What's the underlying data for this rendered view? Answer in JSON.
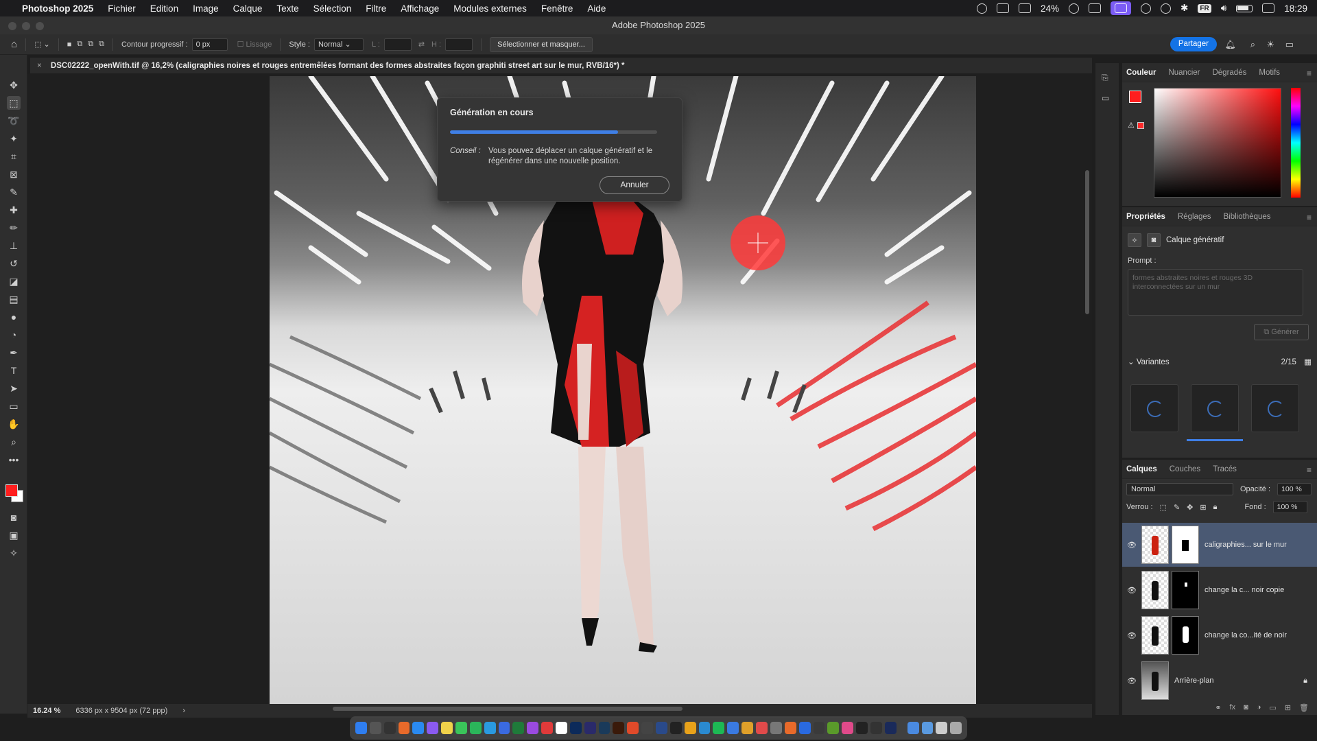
{
  "menubar": {
    "app_name": "Photoshop 2025",
    "items": [
      "Fichier",
      "Edition",
      "Image",
      "Calque",
      "Texte",
      "Sélection",
      "Filtre",
      "Affichage",
      "Modules externes",
      "Fenêtre",
      "Aide"
    ],
    "battery": "24%",
    "lang": "FR",
    "clock": "18:29"
  },
  "window": {
    "title": "Adobe Photoshop 2025"
  },
  "options": {
    "feather_label": "Contour progressif :",
    "feather_value": "0 px",
    "smoothing_label": "Lissage",
    "style_label": "Style :",
    "style_value": "Normal",
    "width_label": "L :",
    "height_label": "H :",
    "select_mask_button": "Sélectionner et masquer...",
    "share_button": "Partager"
  },
  "document": {
    "tab_title": "DSC02222_openWith.tif @ 16,2% (caligraphies noires et rouges entremêlées formant des formes abstraites façon graphiti street art sur le mur, RVB/16*) *"
  },
  "status": {
    "zoom": "16.24 %",
    "dimensions": "6336 px x 9504 px (72 ppp)"
  },
  "modal": {
    "title": "Génération en cours",
    "progress": 0.81,
    "tip_label": "Conseil :",
    "tip_text": "Vous pouvez déplacer un calque génératif et le régénérer dans une nouvelle position.",
    "cancel_button": "Annuler"
  },
  "color_panel": {
    "tabs": [
      "Couleur",
      "Nuancier",
      "Dégradés",
      "Motifs"
    ],
    "foreground": "#ff1e1e",
    "background": "#ffffff"
  },
  "properties_panel": {
    "tabs": [
      "Propriétés",
      "Réglages",
      "Bibliothèques"
    ],
    "layer_type": "Calque génératif",
    "prompt_label": "Prompt :",
    "prompt_placeholder": "formes abstraites noires et rouges 3D interconnectées sur un mur",
    "generate_button": "Générer",
    "variants_label": "Variantes",
    "variants_count": "2/15"
  },
  "layers_panel": {
    "tabs": [
      "Calques",
      "Couches",
      "Tracés"
    ],
    "blend_mode": "Normal",
    "opacity_label": "Opacité :",
    "opacity_value": "100 %",
    "lock_label": "Verrou :",
    "fill_label": "Fond :",
    "fill_value": "100 %",
    "layers": [
      {
        "name": "caligraphies... sur le mur"
      },
      {
        "name": "change la c... noir copie"
      },
      {
        "name": "change la co...ité de noir"
      },
      {
        "name": "Arrière-plan"
      }
    ]
  }
}
